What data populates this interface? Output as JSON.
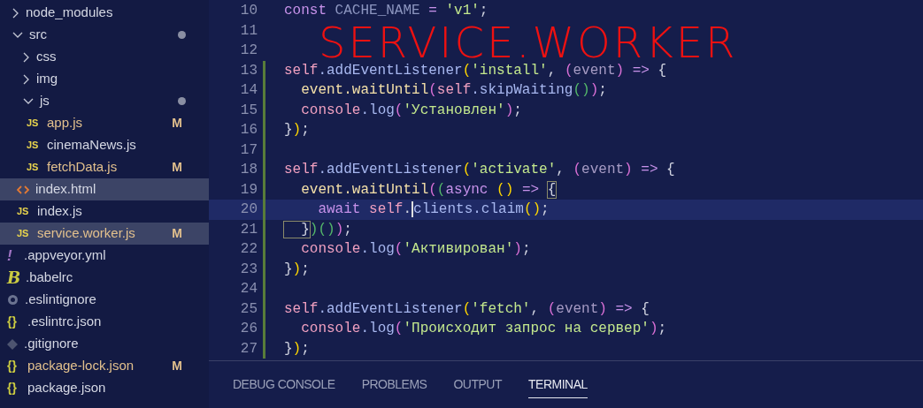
{
  "explorer": {
    "items": [
      {
        "label": "node_modules",
        "kind": "folder",
        "expanded": false,
        "modified": false,
        "dot": false,
        "highlighted": false
      },
      {
        "label": "src",
        "kind": "folder",
        "expanded": true,
        "modified": false,
        "dot": true,
        "highlighted": false,
        "children": [
          {
            "label": "css",
            "kind": "folder",
            "expanded": false,
            "modified": false,
            "dot": false,
            "highlighted": false
          },
          {
            "label": "img",
            "kind": "folder",
            "expanded": false,
            "modified": false,
            "dot": false,
            "highlighted": false
          },
          {
            "label": "js",
            "kind": "folder",
            "expanded": true,
            "modified": false,
            "dot": true,
            "highlighted": false,
            "children": [
              {
                "label": "app.js",
                "kind": "js",
                "icon": "JS",
                "modified": true,
                "badge": "M",
                "highlighted": false
              },
              {
                "label": "cinemaNews.js",
                "kind": "js",
                "icon": "JS",
                "modified": false,
                "highlighted": false
              },
              {
                "label": "fetchData.js",
                "kind": "js",
                "icon": "JS",
                "modified": true,
                "badge": "M",
                "highlighted": false
              }
            ]
          },
          {
            "label": "index.html",
            "kind": "html",
            "modified": false,
            "highlighted": true
          },
          {
            "label": "index.js",
            "kind": "js",
            "icon": "JS",
            "modified": false,
            "highlighted": false
          },
          {
            "label": "service.worker.js",
            "kind": "js",
            "icon": "JS",
            "modified": true,
            "badge": "M",
            "highlighted": true
          }
        ]
      },
      {
        "label": ".appveyor.yml",
        "kind": "yaml",
        "icon": "!",
        "modified": false,
        "highlighted": false
      },
      {
        "label": ".babelrc",
        "kind": "babel",
        "icon": "B",
        "modified": false,
        "highlighted": false
      },
      {
        "label": ".eslintignore",
        "kind": "eslint",
        "modified": false,
        "highlighted": false
      },
      {
        "label": ".eslintrc.json",
        "kind": "json",
        "icon": "{}",
        "modified": false,
        "highlighted": false
      },
      {
        "label": ".gitignore",
        "kind": "git",
        "modified": false,
        "highlighted": false
      },
      {
        "label": "package-lock.json",
        "kind": "json",
        "icon": "{}",
        "modified": true,
        "badge": "M",
        "highlighted": false
      },
      {
        "label": "package.json",
        "kind": "json",
        "icon": "{}",
        "modified": false,
        "highlighted": false
      }
    ]
  },
  "editor": {
    "annotation": "SERVICE.WORKER",
    "lines": [
      {
        "number": "10",
        "git_modified": false,
        "current": false,
        "tokens": [
          {
            "text": "const",
            "kind": "keyword"
          },
          {
            "text": " CACHE_NAME ",
            "kind": "const"
          },
          {
            "text": "=",
            "kind": "op"
          },
          {
            "text": " 'v1'",
            "kind": "string"
          },
          {
            "text": ";",
            "kind": "plain"
          }
        ]
      },
      {
        "number": "11",
        "git_modified": false,
        "current": false
      },
      {
        "number": "12",
        "git_modified": false,
        "current": false
      },
      {
        "number": "13",
        "git_modified": true,
        "current": false,
        "tokens": [
          {
            "text": "self",
            "kind": "var"
          },
          {
            "text": ".addEventListener",
            "kind": "method"
          },
          {
            "text": "(",
            "kind": "b1"
          },
          {
            "text": "'install'",
            "kind": "string"
          },
          {
            "text": ", ",
            "kind": "plain"
          },
          {
            "text": "(",
            "kind": "b2"
          },
          {
            "text": "event",
            "kind": "param"
          },
          {
            "text": ")",
            "kind": "b2"
          },
          {
            "text": " => ",
            "kind": "op"
          },
          {
            "text": "{",
            "kind": "plain"
          }
        ]
      },
      {
        "number": "14",
        "git_modified": true,
        "current": false,
        "tokens": [
          {
            "text": "  event",
            "kind": "fn"
          },
          {
            "text": ".waitUntil",
            "kind": "fn"
          },
          {
            "text": "(",
            "kind": "b2"
          },
          {
            "text": "self",
            "kind": "var"
          },
          {
            "text": ".skipWaiting",
            "kind": "method"
          },
          {
            "text": "()",
            "kind": "b3"
          },
          {
            "text": ")",
            "kind": "b2"
          },
          {
            "text": ";",
            "kind": "plain"
          }
        ]
      },
      {
        "number": "15",
        "git_modified": true,
        "current": false,
        "tokens": [
          {
            "text": "  console",
            "kind": "var"
          },
          {
            "text": ".log",
            "kind": "method"
          },
          {
            "text": "(",
            "kind": "b2"
          },
          {
            "text": "'Установлен'",
            "kind": "string"
          },
          {
            "text": ")",
            "kind": "b2"
          },
          {
            "text": ";",
            "kind": "plain"
          }
        ]
      },
      {
        "number": "16",
        "git_modified": true,
        "current": false,
        "tokens": [
          {
            "text": "}",
            "kind": "plain"
          },
          {
            "text": ")",
            "kind": "b1"
          },
          {
            "text": ";",
            "kind": "plain"
          }
        ]
      },
      {
        "number": "17",
        "git_modified": true,
        "current": false
      },
      {
        "number": "18",
        "git_modified": true,
        "current": false,
        "tokens": [
          {
            "text": "self",
            "kind": "var"
          },
          {
            "text": ".addEventListener",
            "kind": "method"
          },
          {
            "text": "(",
            "kind": "b1"
          },
          {
            "text": "'activate'",
            "kind": "string"
          },
          {
            "text": ", ",
            "kind": "plain"
          },
          {
            "text": "(",
            "kind": "b2"
          },
          {
            "text": "event",
            "kind": "param"
          },
          {
            "text": ")",
            "kind": "b2"
          },
          {
            "text": " => ",
            "kind": "op"
          },
          {
            "text": "{",
            "kind": "plain"
          }
        ]
      },
      {
        "number": "19",
        "git_modified": true,
        "current": false,
        "tokens": [
          {
            "text": "  event",
            "kind": "fn"
          },
          {
            "text": ".waitUntil",
            "kind": "fn"
          },
          {
            "text": "(",
            "kind": "b2"
          },
          {
            "text": "(",
            "kind": "b3"
          },
          {
            "text": "async",
            "kind": "keyword"
          },
          {
            "text": " ()",
            "kind": "b1"
          },
          {
            "text": " => ",
            "kind": "op"
          },
          {
            "text": "{",
            "kind": "plain",
            "matched": true
          }
        ]
      },
      {
        "number": "20",
        "git_modified": true,
        "current": true,
        "tokens": [
          {
            "text": "    await",
            "kind": "keyword"
          },
          {
            "text": " self",
            "kind": "var"
          },
          {
            "text": ".",
            "kind": "plain"
          },
          {
            "text": "clients",
            "kind": "method",
            "cursor_before": true
          },
          {
            "text": ".claim",
            "kind": "method"
          },
          {
            "text": "()",
            "kind": "b1"
          },
          {
            "text": ";",
            "kind": "plain"
          }
        ]
      },
      {
        "number": "21",
        "git_modified": true,
        "current": false,
        "tokens": [
          {
            "text": "  }",
            "kind": "plain",
            "matched": true
          },
          {
            "text": ")",
            "kind": "b3"
          },
          {
            "text": "()",
            "kind": "b3"
          },
          {
            "text": ")",
            "kind": "b2"
          },
          {
            "text": ";",
            "kind": "plain"
          }
        ]
      },
      {
        "number": "22",
        "git_modified": true,
        "current": false,
        "tokens": [
          {
            "text": "  console",
            "kind": "var"
          },
          {
            "text": ".log",
            "kind": "method"
          },
          {
            "text": "(",
            "kind": "b2"
          },
          {
            "text": "'Активирован'",
            "kind": "string"
          },
          {
            "text": ")",
            "kind": "b2"
          },
          {
            "text": ";",
            "kind": "plain"
          }
        ]
      },
      {
        "number": "23",
        "git_modified": true,
        "current": false,
        "tokens": [
          {
            "text": "}",
            "kind": "plain"
          },
          {
            "text": ")",
            "kind": "b1"
          },
          {
            "text": ";",
            "kind": "plain"
          }
        ]
      },
      {
        "number": "24",
        "git_modified": true,
        "current": false
      },
      {
        "number": "25",
        "git_modified": true,
        "current": false,
        "tokens": [
          {
            "text": "self",
            "kind": "var"
          },
          {
            "text": ".addEventListener",
            "kind": "method"
          },
          {
            "text": "(",
            "kind": "b1"
          },
          {
            "text": "'fetch'",
            "kind": "string"
          },
          {
            "text": ", ",
            "kind": "plain"
          },
          {
            "text": "(",
            "kind": "b2"
          },
          {
            "text": "event",
            "kind": "param"
          },
          {
            "text": ")",
            "kind": "b2"
          },
          {
            "text": " => ",
            "kind": "op"
          },
          {
            "text": "{",
            "kind": "plain"
          }
        ]
      },
      {
        "number": "26",
        "git_modified": true,
        "current": false,
        "tokens": [
          {
            "text": "  console",
            "kind": "var"
          },
          {
            "text": ".log",
            "kind": "method"
          },
          {
            "text": "(",
            "kind": "b2"
          },
          {
            "text": "'Происходит запрос на сервер'",
            "kind": "string"
          },
          {
            "text": ")",
            "kind": "b2"
          },
          {
            "text": ";",
            "kind": "plain"
          }
        ]
      },
      {
        "number": "27",
        "git_modified": true,
        "current": false,
        "tokens": [
          {
            "text": "}",
            "kind": "plain"
          },
          {
            "text": ")",
            "kind": "b1"
          },
          {
            "text": ";",
            "kind": "plain"
          }
        ]
      }
    ]
  },
  "panel": {
    "tabs": [
      {
        "label": "DEBUG CONSOLE",
        "selected": false
      },
      {
        "label": "PROBLEMS",
        "selected": false
      },
      {
        "label": "OUTPUT",
        "selected": false
      },
      {
        "label": "TERMINAL",
        "selected": true
      }
    ]
  }
}
